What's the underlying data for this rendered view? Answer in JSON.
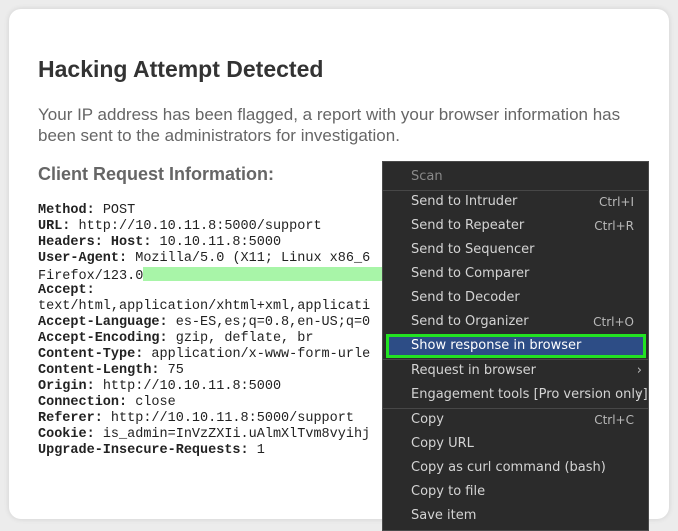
{
  "colors": {
    "highlight": "#a8f5a8",
    "menu_bg": "#2b2b2b",
    "menu_selected": "#2d4d86",
    "focus_outline": "#22e322"
  },
  "page": {
    "title": "Hacking Attempt Detected",
    "description": "Your IP address has been flagged, a report with your browser information has been sent to the administrators for investigation.",
    "subtitle": "Client Request Information:"
  },
  "request": [
    {
      "key": "Method:",
      "value": " POST"
    },
    {
      "key": "URL:",
      "value": " http://10.10.11.8:5000/support"
    },
    {
      "key": "Headers: Host:",
      "value": " 10.10.11.8:5000"
    },
    {
      "key": "User-Agent:",
      "value": " Mozilla/5.0 (X11; Linux x86_6"
    },
    {
      "key": "",
      "value": "Firefox/123.0",
      "highlight": true
    },
    {
      "key": "Accept:",
      "value": ""
    },
    {
      "key": "",
      "value": "text/html,application/xhtml+xml,applicati"
    },
    {
      "key": "Accept-Language:",
      "value": " es-ES,es;q=0.8,en-US;q=0"
    },
    {
      "key": "Accept-Encoding:",
      "value": " gzip, deflate, br"
    },
    {
      "key": "Content-Type:",
      "value": " application/x-www-form-urle"
    },
    {
      "key": "Content-Length:",
      "value": " 75"
    },
    {
      "key": "Origin:",
      "value": " http://10.10.11.8:5000"
    },
    {
      "key": "Connection:",
      "value": " close"
    },
    {
      "key": "Referer:",
      "value": " http://10.10.11.8:5000/support"
    },
    {
      "key": "Cookie:",
      "value": " is_admin=InVzZXIi.uAlmXlTvm8vyihj"
    },
    {
      "key": "Upgrade-Insecure-Requests:",
      "value": " 1"
    }
  ],
  "context_menu": {
    "items": [
      {
        "label": "Scan",
        "shortcut": "",
        "disabled": true
      },
      {
        "label": "Send to Intruder",
        "shortcut": "Ctrl+I"
      },
      {
        "label": "Send to Repeater",
        "shortcut": "Ctrl+R"
      },
      {
        "label": "Send to Sequencer",
        "shortcut": ""
      },
      {
        "label": "Send to Comparer",
        "shortcut": ""
      },
      {
        "label": "Send to Decoder",
        "shortcut": ""
      },
      {
        "label": "Send to Organizer",
        "shortcut": "Ctrl+O"
      },
      {
        "label": "Show response in browser",
        "shortcut": "",
        "selected": true
      },
      {
        "label": "Request in browser",
        "shortcut": "",
        "submenu": true
      },
      {
        "label": "Engagement tools [Pro version only]",
        "shortcut": "",
        "submenu": true
      },
      {
        "label": "Copy",
        "shortcut": "Ctrl+C"
      },
      {
        "label": "Copy URL",
        "shortcut": ""
      },
      {
        "label": "Copy as curl command (bash)",
        "shortcut": ""
      },
      {
        "label": "Copy to file",
        "shortcut": ""
      },
      {
        "label": "Save item",
        "shortcut": ""
      }
    ]
  }
}
